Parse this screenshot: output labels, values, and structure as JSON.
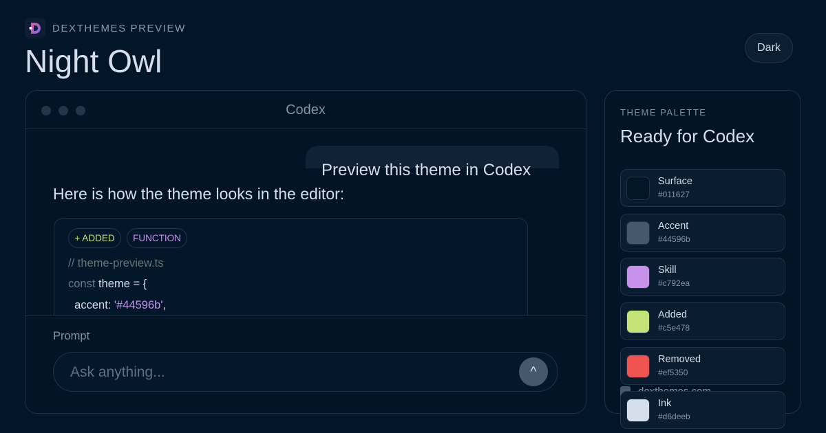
{
  "header": {
    "eyebrow": "DEXTHEMES PREVIEW",
    "title": "Night Owl",
    "mode_label": "Dark"
  },
  "window": {
    "title": "Codex",
    "user_message": "Preview this theme in Codex",
    "assistant_message": "Here is how the theme looks in the editor:",
    "code": {
      "tags": {
        "added": "+ ADDED",
        "function": "FUNCTION"
      },
      "line1": "// theme-preview.ts",
      "line2_keyword": "const",
      "line2_rest": " theme = {",
      "line3_key": "  accent: ",
      "line3_value": "'#44596b'",
      "line3_end": ","
    },
    "prompt": {
      "label": "Prompt",
      "placeholder": "Ask anything...",
      "send_icon": "^"
    }
  },
  "palette": {
    "eyebrow": "THEME PALETTE",
    "title": "Ready for Codex",
    "swatches": [
      {
        "name": "Surface",
        "hex": "#011627"
      },
      {
        "name": "Accent",
        "hex": "#44596b"
      },
      {
        "name": "Skill",
        "hex": "#c792ea"
      },
      {
        "name": "Added",
        "hex": "#c5e478"
      },
      {
        "name": "Removed",
        "hex": "#ef5350"
      },
      {
        "name": "Ink",
        "hex": "#d6deeb"
      }
    ]
  },
  "footer": {
    "site": "dexthemes.com"
  },
  "colors": {
    "background": "#031629",
    "accent": "#44596b",
    "ink": "#d6deeb"
  }
}
